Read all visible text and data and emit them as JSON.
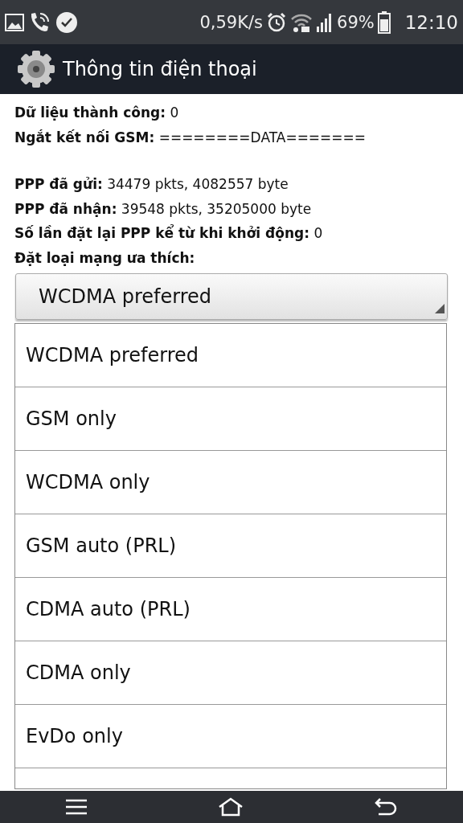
{
  "status_bar": {
    "speed": "0,59K/s",
    "battery": "69%",
    "time": "12:10"
  },
  "app_bar": {
    "title": "Thông tin điện thoại"
  },
  "data_lines": [
    "**Dữ liệu thành công:** 0",
    "**Ngắt kết nối GSM:** ========DATA======="
  ],
  "ppp_lines": [
    "**PPP đã gửi:** 34479 pkts, 4082557 byte",
    "**PPP đã nhận:** 39548 pkts, 35205000 byte",
    "**Số lần đặt lại PPP kể từ khi khởi động:** 0",
    "**Đặt loại mạng ưa thích:**"
  ],
  "spinner": {
    "value": "WCDMA preferred"
  },
  "dropdown": {
    "options": [
      "WCDMA preferred",
      "GSM only",
      "WCDMA only",
      "GSM auto (PRL)",
      "CDMA auto (PRL)",
      "CDMA only",
      "EvDo only"
    ]
  }
}
